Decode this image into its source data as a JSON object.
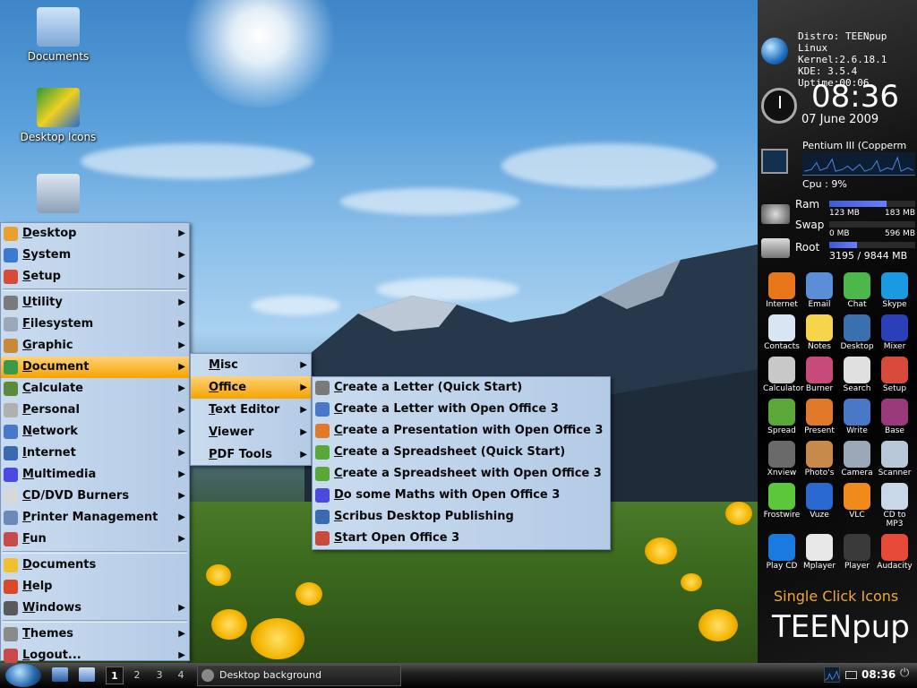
{
  "desktop_icons": [
    {
      "label": "Documents"
    },
    {
      "label": "Desktop Icons"
    }
  ],
  "main_menu": {
    "items": [
      {
        "label": "Desktop",
        "hotkey": "D",
        "rest": "esktop",
        "submenu": true
      },
      {
        "label": "System",
        "hotkey": "S",
        "rest": "ystem",
        "submenu": true
      },
      {
        "label": "Setup",
        "hotkey": "S",
        "rest": "etup",
        "submenu": true
      },
      {
        "label": "Utility",
        "hotkey": "U",
        "rest": "tility",
        "submenu": true
      },
      {
        "label": "Filesystem",
        "hotkey": "F",
        "rest": "ilesystem",
        "submenu": true
      },
      {
        "label": "Graphic",
        "hotkey": "G",
        "rest": "raphic",
        "submenu": true
      },
      {
        "label": "Document",
        "hotkey": "D",
        "rest": "ocument",
        "submenu": true
      },
      {
        "label": "Calculate",
        "hotkey": "C",
        "rest": "alculate",
        "submenu": true
      },
      {
        "label": "Personal",
        "hotkey": "P",
        "rest": "ersonal",
        "submenu": true
      },
      {
        "label": "Network",
        "hotkey": "N",
        "rest": "etwork",
        "submenu": true
      },
      {
        "label": "Internet",
        "hotkey": "I",
        "rest": "nternet",
        "submenu": true
      },
      {
        "label": "Multimedia",
        "hotkey": "M",
        "rest": "ultimedia",
        "submenu": true
      },
      {
        "label": "CD/DVD Burners",
        "hotkey": "C",
        "rest": "D/DVD Burners",
        "submenu": true
      },
      {
        "label": "Printer Management",
        "hotkey": "P",
        "rest": "rinter Management",
        "submenu": true
      },
      {
        "label": "Fun",
        "hotkey": "F",
        "rest": "un",
        "submenu": true
      },
      {
        "label": "Documents",
        "hotkey": "D",
        "rest": "ocuments",
        "submenu": false
      },
      {
        "label": "Help",
        "hotkey": "H",
        "rest": "elp",
        "submenu": false
      },
      {
        "label": "Windows",
        "hotkey": "W",
        "rest": "indows",
        "submenu": true
      },
      {
        "label": "Themes",
        "hotkey": "T",
        "rest": "hemes",
        "submenu": true
      },
      {
        "label": "Logout...",
        "hotkey": "L",
        "rest": "ogout...",
        "submenu": true
      }
    ],
    "active_index": 6
  },
  "document_submenu": {
    "items": [
      {
        "label": "Misc",
        "hotkey": "M",
        "rest": "isc"
      },
      {
        "label": "Office",
        "hotkey": "O",
        "rest": "ffice"
      },
      {
        "label": "Text Editor",
        "hotkey": "T",
        "rest": "ext Editor"
      },
      {
        "label": "Viewer",
        "hotkey": "V",
        "rest": "iewer"
      },
      {
        "label": "PDF Tools",
        "hotkey": "P",
        "rest": "DF Tools"
      }
    ],
    "active_index": 1
  },
  "office_submenu": {
    "items": [
      {
        "label": "Create a Letter (Quick Start)",
        "hotkey": "C",
        "rest": "reate a Letter (Quick Start)"
      },
      {
        "label": "Create a Letter with Open Office 3",
        "hotkey": "C",
        "rest": "reate a Letter with Open Office 3"
      },
      {
        "label": "Create a Presentation with Open Office 3",
        "hotkey": "C",
        "rest": "reate a Presentation with Open Office 3"
      },
      {
        "label": "Create a Spreadsheet (Quick Start)",
        "hotkey": "C",
        "rest": "reate a Spreadsheet (Quick Start)"
      },
      {
        "label": "Create a Spreadsheet with Open Office 3",
        "hotkey": "C",
        "rest": "reate a Spreadsheet with Open Office 3"
      },
      {
        "label": "Do some Maths with Open Office 3",
        "hotkey": "D",
        "rest": "o some Maths with Open Office 3"
      },
      {
        "label": "Scribus Desktop Publishing",
        "hotkey": "S",
        "rest": "cribus Desktop Publishing"
      },
      {
        "label": "Start Open Office 3",
        "hotkey": "S",
        "rest": "tart Open Office 3"
      }
    ]
  },
  "panel": {
    "distro": "Distro: TEENpup Linux",
    "kernel": "Kernel:2.6.18.1",
    "kde": "KDE:   3.5.4",
    "uptime": "Uptime:00:06",
    "time": "08:36",
    "date": "07 June 2009",
    "cpu_name": "Pentium III (Copperm",
    "cpu_usage": "Cpu  :  9%",
    "ram_label": "Ram",
    "ram_used": "123 MB",
    "ram_total": "183 MB",
    "ram_fraction": 0.67,
    "swap_label": "Swap",
    "swap_used": "0 MB",
    "swap_total": "596 MB",
    "swap_fraction": 0.0,
    "root_label": "Root",
    "root_usage": "3195 / 9844 MB",
    "root_fraction": 0.32,
    "apps": [
      {
        "label": "Internet",
        "color": "#e8771c"
      },
      {
        "label": "Email",
        "color": "#5a8ed6"
      },
      {
        "label": "Chat",
        "color": "#4cb84c"
      },
      {
        "label": "Skype",
        "color": "#1a9ae0"
      },
      {
        "label": "Contacts",
        "color": "#d8e6f4"
      },
      {
        "label": "Notes",
        "color": "#f5d64a"
      },
      {
        "label": "Desktop",
        "color": "#3a6fb0"
      },
      {
        "label": "Mixer",
        "color": "#2a3fb8"
      },
      {
        "label": "Calculator",
        "color": "#c8c8c8"
      },
      {
        "label": "Burner",
        "color": "#c74a7a"
      },
      {
        "label": "Search",
        "color": "#e0e0e0"
      },
      {
        "label": "Setup",
        "color": "#d84a3a"
      },
      {
        "label": "Spread",
        "color": "#5aa83a"
      },
      {
        "label": "Present",
        "color": "#e07a2a"
      },
      {
        "label": "Write",
        "color": "#4a78c8"
      },
      {
        "label": "Base",
        "color": "#9a3a7a"
      },
      {
        "label": "Xnview",
        "color": "#6a6a6a"
      },
      {
        "label": "Photo's",
        "color": "#c88a4a"
      },
      {
        "label": "Camera",
        "color": "#9aa8b8"
      },
      {
        "label": "Scanner",
        "color": "#b8c8d8"
      },
      {
        "label": "Frostwire",
        "color": "#5ac83a"
      },
      {
        "label": "Vuze",
        "color": "#2a6ad0"
      },
      {
        "label": "VLC",
        "color": "#f08a1a"
      },
      {
        "label": "CD to MP3",
        "color": "#c8d8e8"
      },
      {
        "label": "Play CD",
        "color": "#1a7ae0"
      },
      {
        "label": "Mplayer",
        "color": "#e8e8e8"
      },
      {
        "label": "Player",
        "color": "#3a3a3a"
      },
      {
        "label": "Audacity",
        "color": "#e84a3a"
      }
    ],
    "single_click": "Single Click Icons",
    "brand": "TEENpup"
  },
  "taskbar": {
    "desktops": [
      "1",
      "2",
      "3",
      "4"
    ],
    "current_desktop": "1",
    "task_label": "Desktop background",
    "clock": "08:36"
  }
}
